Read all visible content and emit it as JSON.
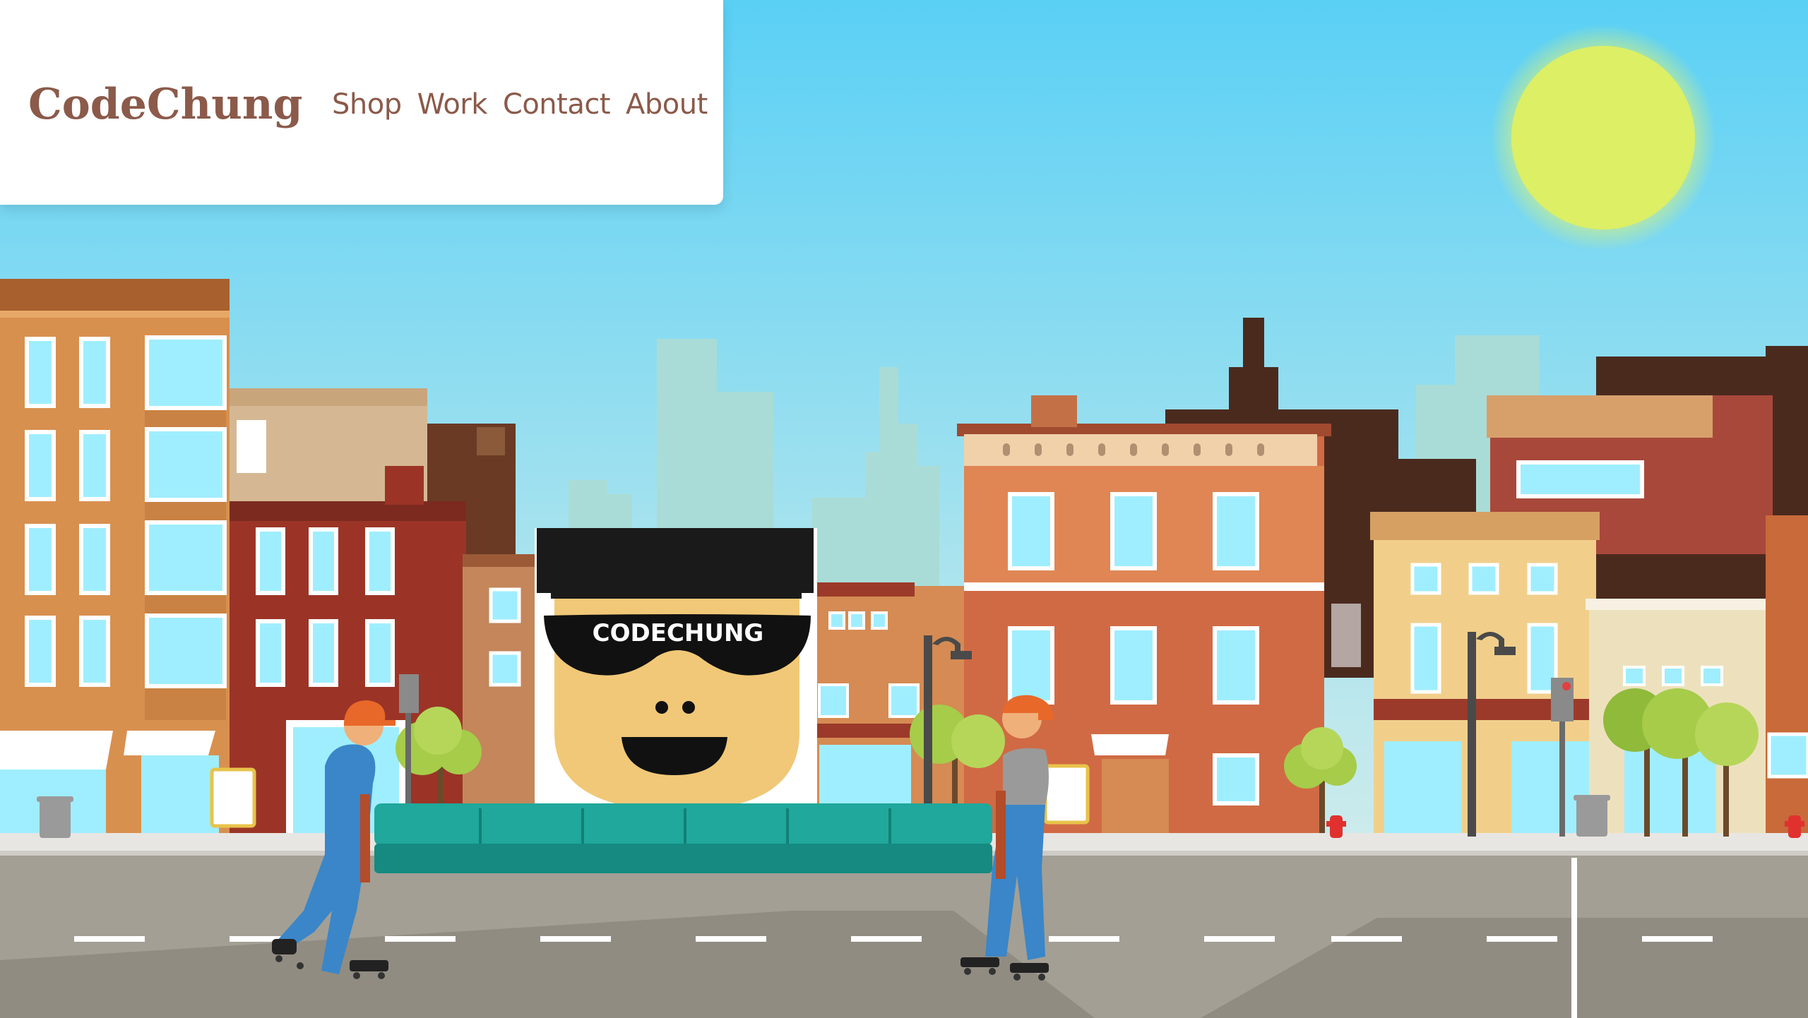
{
  "header": {
    "brand": "CodeChung",
    "nav": [
      {
        "label": "Shop"
      },
      {
        "label": "Work"
      },
      {
        "label": "Contact"
      },
      {
        "label": "About"
      }
    ]
  },
  "hero": {
    "box_label": "CODECHUNG"
  },
  "colors": {
    "brand_text": "#8b5a4a",
    "sky_top": "#5ad0f5",
    "sky_bottom": "#d6eef0",
    "sun": "#dbf065",
    "road": "#a39f95",
    "sofa": "#1e9a8f"
  },
  "icons": [
    "sun-icon",
    "trash-can-icon",
    "fire-hydrant-icon",
    "traffic-light-icon",
    "street-lamp-icon",
    "tree-icon"
  ]
}
